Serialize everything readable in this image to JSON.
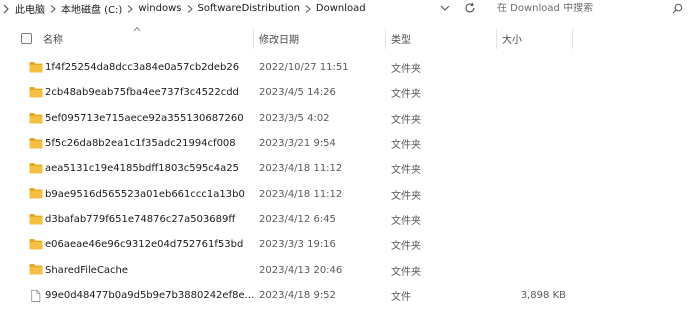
{
  "address": {
    "breadcrumbs": [
      "此电脑",
      "本地磁盘 (C:)",
      "windows",
      "SoftwareDistribution",
      "Download"
    ]
  },
  "search": {
    "placeholder": "在 Download 中搜索"
  },
  "columns": {
    "name": "名称",
    "date": "修改日期",
    "type": "类型",
    "size": "大小"
  },
  "files": [
    {
      "name": "1f4f25254da8dcc3a84e0a57cb2deb26",
      "date": "2022/10/27 11:51",
      "type": "文件夹",
      "size": "",
      "icon": "folder-icon"
    },
    {
      "name": "2cb48ab9eab75fba4ee737f3c4522cdd",
      "date": "2023/4/5 14:26",
      "type": "文件夹",
      "size": "",
      "icon": "folder-icon"
    },
    {
      "name": "5ef095713e715aece92a355130687260",
      "date": "2023/3/5 4:02",
      "type": "文件夹",
      "size": "",
      "icon": "folder-icon"
    },
    {
      "name": "5f5c26da8b2ea1c1f35adc21994cf008",
      "date": "2023/3/21 9:54",
      "type": "文件夹",
      "size": "",
      "icon": "folder-icon"
    },
    {
      "name": "aea5131c19e4185bdff1803c595c4a25",
      "date": "2023/4/18 11:12",
      "type": "文件夹",
      "size": "",
      "icon": "folder-icon"
    },
    {
      "name": "b9ae9516d565523a01eb661ccc1a13b0",
      "date": "2023/4/18 11:12",
      "type": "文件夹",
      "size": "",
      "icon": "folder-icon"
    },
    {
      "name": "d3bafab779f651e74876c27a503689ff",
      "date": "2023/4/12 6:45",
      "type": "文件夹",
      "size": "",
      "icon": "folder-icon"
    },
    {
      "name": "e06aeae46e96c9312e04d752761f53bd",
      "date": "2023/3/3 19:16",
      "type": "文件夹",
      "size": "",
      "icon": "folder-icon"
    },
    {
      "name": "SharedFileCache",
      "date": "2023/4/13 20:46",
      "type": "文件夹",
      "size": "",
      "icon": "folder-icon"
    },
    {
      "name": "99e0d48477b0a9d5b9e7b3880242ef8e...",
      "date": "2023/4/18 9:52",
      "type": "文件",
      "size": "3,898 KB",
      "icon": "file-icon"
    }
  ],
  "colors": {
    "folder": "#f5c042",
    "folder_dark": "#e4a820",
    "text": "#1a1a1a",
    "secondary": "#5a5a5a"
  }
}
